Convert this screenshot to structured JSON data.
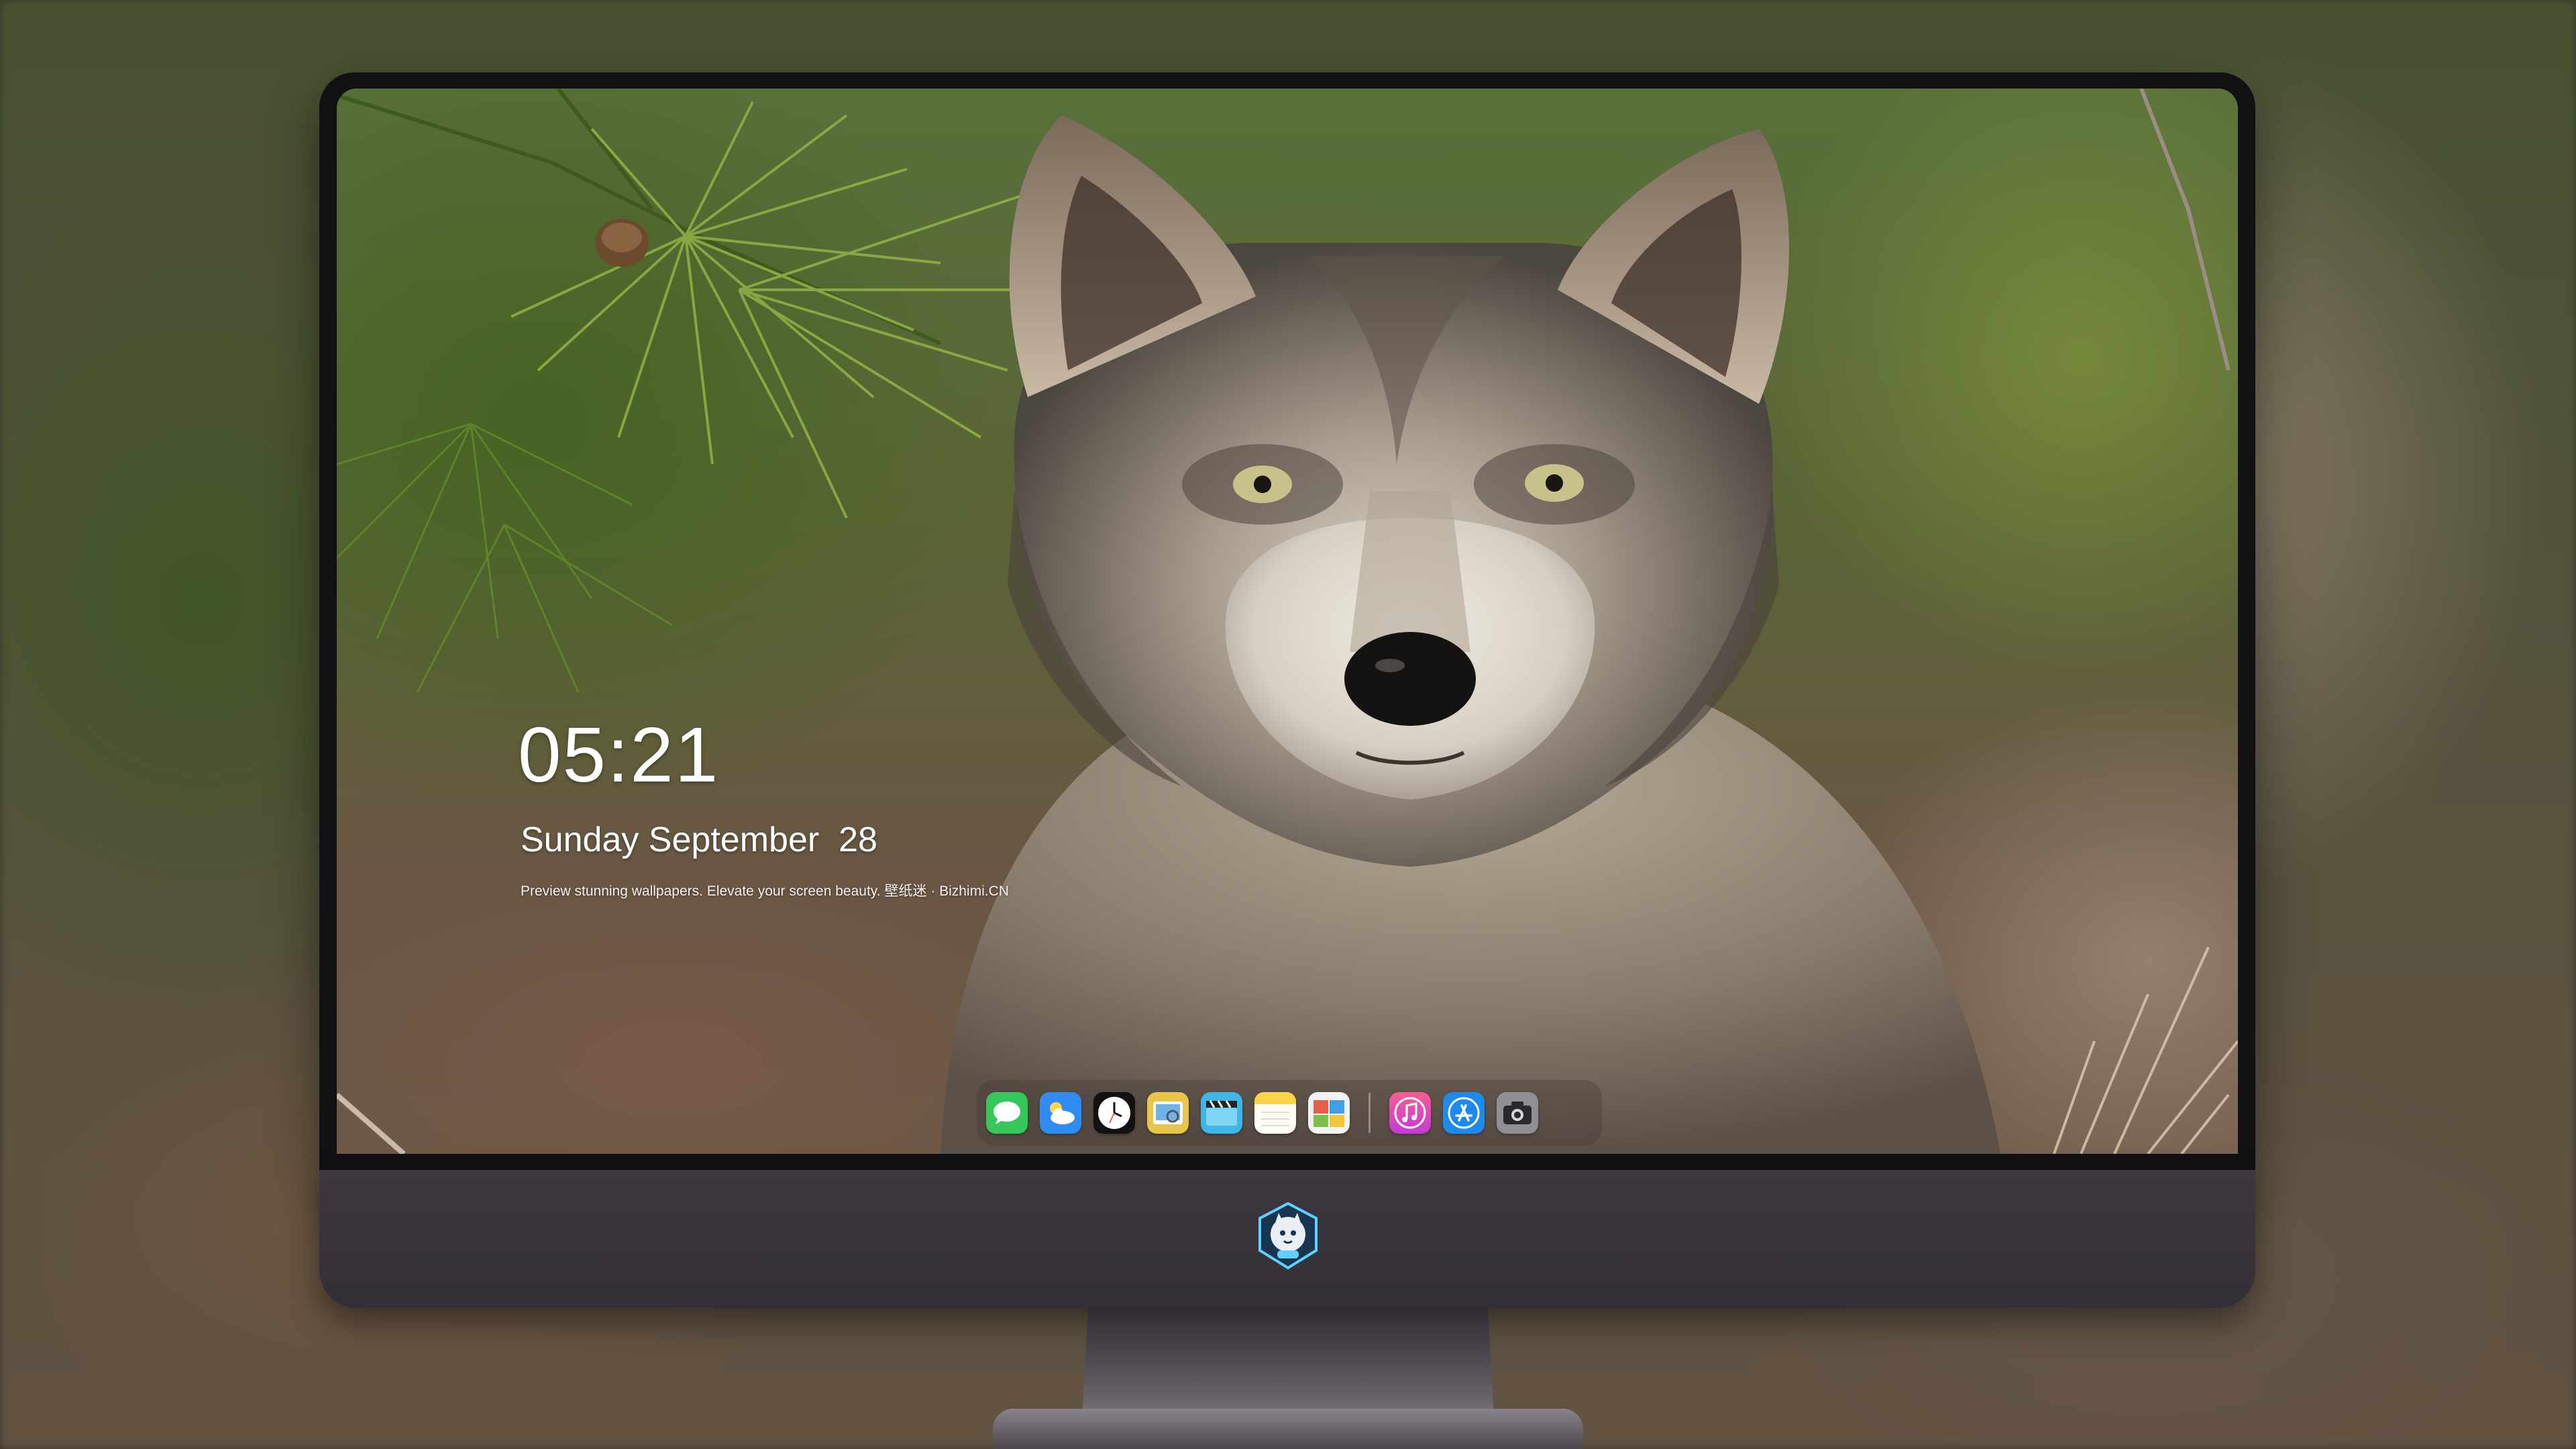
{
  "lock_screen": {
    "time": "05:21",
    "date": "Sunday September  28",
    "tagline": "Preview stunning wallpapers. Elevate your screen beauty. 壁纸迷 · Bizhimi.CN"
  },
  "dock": {
    "apps": [
      {
        "name": "Messages",
        "icon": "messages-icon",
        "color": "#35c759"
      },
      {
        "name": "Weather",
        "icon": "weather-icon",
        "color": "#2f8cf0"
      },
      {
        "name": "Clock",
        "icon": "clock-icon",
        "color": "#111111"
      },
      {
        "name": "Preview",
        "icon": "preview-icon",
        "color": "#e9c54a"
      },
      {
        "name": "Clips",
        "icon": "clips-icon",
        "color": "#3fb7e6"
      },
      {
        "name": "Notes",
        "icon": "notes-icon",
        "color": "#fdd447"
      },
      {
        "name": "Photo Booth",
        "icon": "photo-icon",
        "color": "#7c9c3a"
      },
      {
        "name": "Music",
        "icon": "music-icon",
        "color": "#f24c8c"
      },
      {
        "name": "App Store",
        "icon": "app-store-icon",
        "color": "#1d8af0"
      },
      {
        "name": "Camera",
        "icon": "camera-icon",
        "color": "#8e8e93"
      }
    ]
  },
  "device": {
    "chin_logo": "mascot-logo-icon"
  }
}
